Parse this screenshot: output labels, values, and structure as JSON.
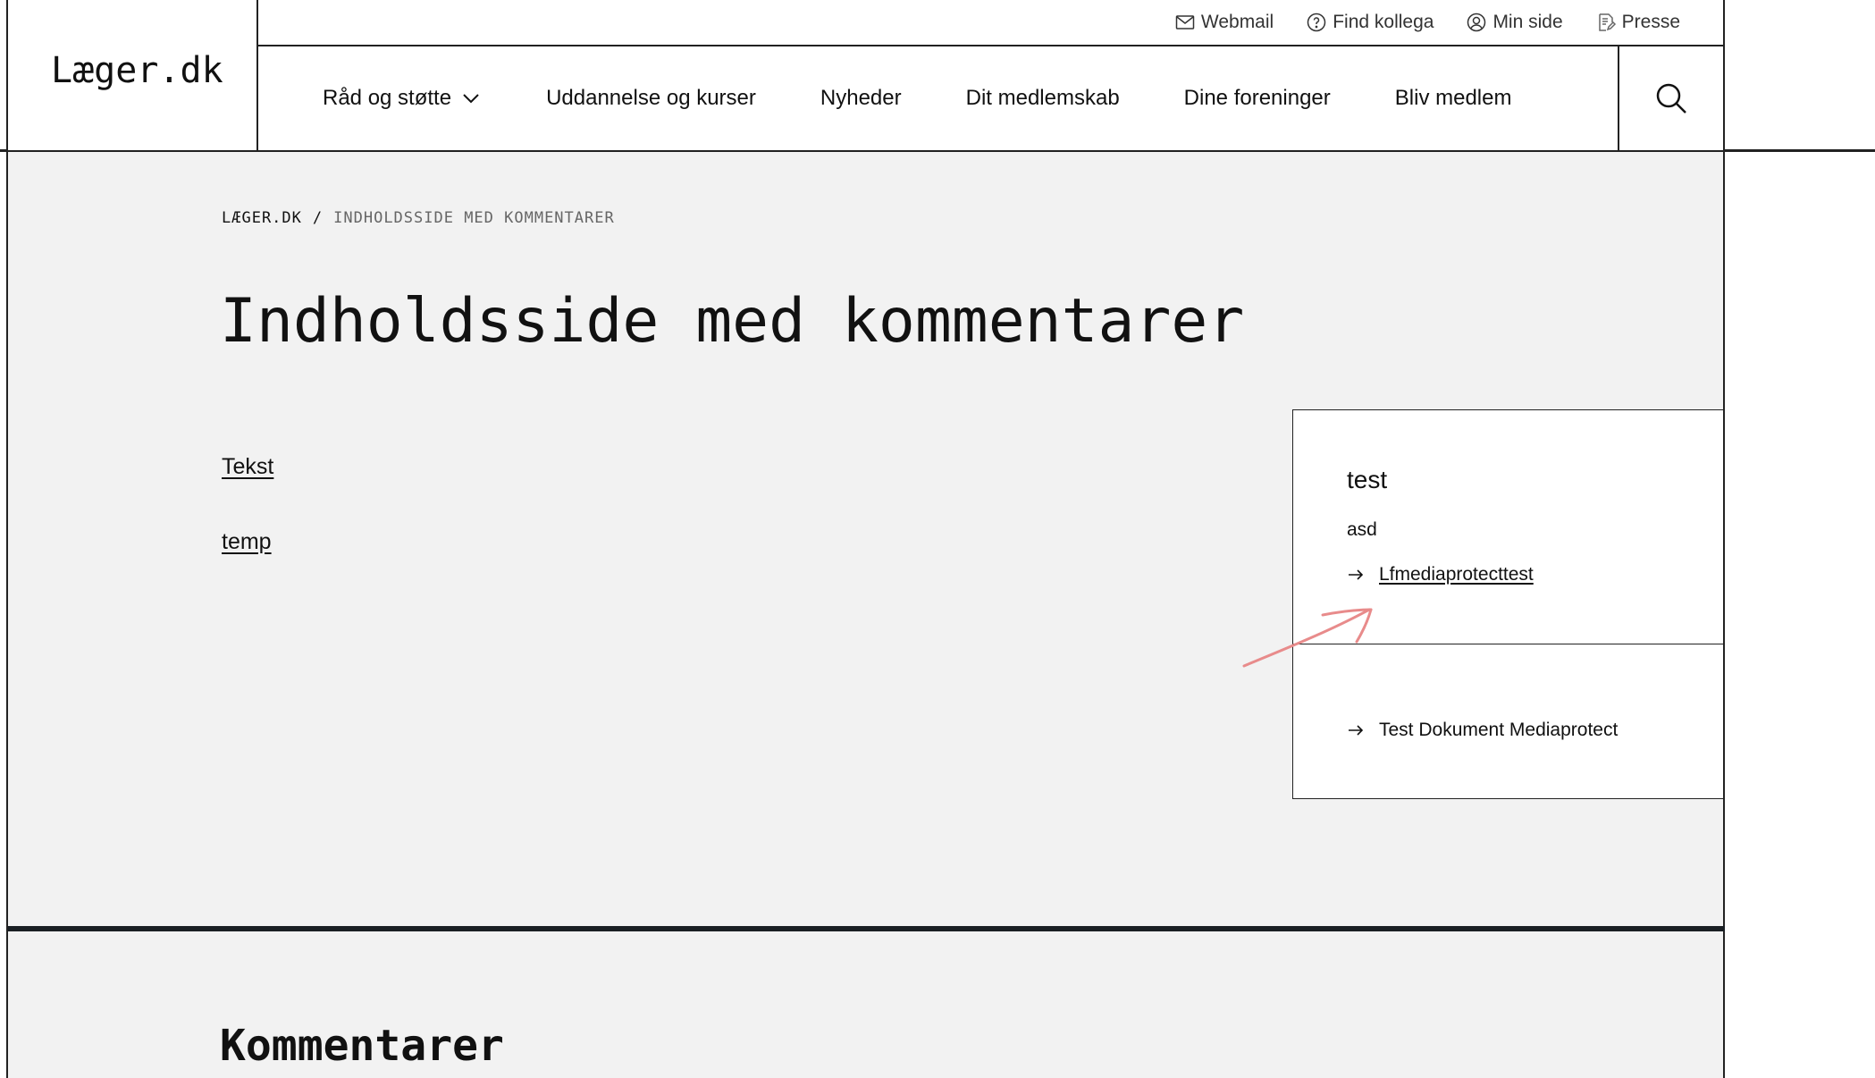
{
  "brand": {
    "logo": "Læger.dk"
  },
  "utility_nav": [
    {
      "label": "Webmail",
      "icon": "mail-icon"
    },
    {
      "label": "Find kollega",
      "icon": "help-circle-icon"
    },
    {
      "label": "Min side",
      "icon": "user-circle-icon"
    },
    {
      "label": "Presse",
      "icon": "document-edit-icon"
    }
  ],
  "main_nav": [
    {
      "label": "Råd og støtte",
      "has_dropdown": true
    },
    {
      "label": "Uddannelse og kurser"
    },
    {
      "label": "Nyheder"
    },
    {
      "label": "Dit medlemskab"
    },
    {
      "label": "Dine foreninger"
    },
    {
      "label": "Bliv medlem"
    }
  ],
  "breadcrumb": {
    "home": "LÆGER.DK",
    "separator": "/",
    "current": "INDHOLDSSIDE MED KOMMENTARER"
  },
  "page": {
    "title": "Indholdsside med kommentarer",
    "links": [
      "Tekst",
      "temp"
    ]
  },
  "sidebar": {
    "card1": {
      "title": "test",
      "text": "asd",
      "link": "Lfmediaprotecttest"
    },
    "card2": {
      "link": "Test Dokument Mediaprotect"
    }
  },
  "comments": {
    "title": "Kommentarer"
  },
  "colors": {
    "background": "#f2f2f2",
    "border": "#222222",
    "divider": "#1a1f24",
    "annotation": "#e88b8b"
  }
}
